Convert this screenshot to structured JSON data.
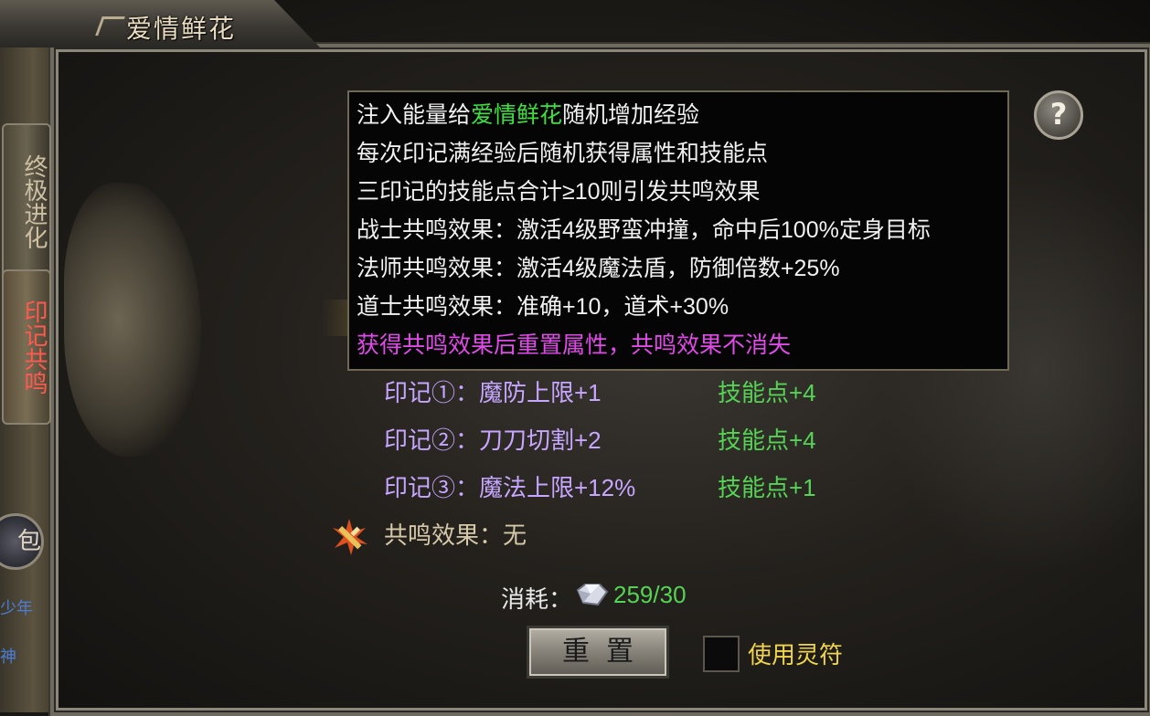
{
  "window": {
    "title": "爱情鲜花"
  },
  "side_tabs": [
    {
      "label": "终极进化"
    },
    {
      "label": "印记共鸣"
    }
  ],
  "side_partial": {
    "circle_text": "包",
    "blue1": "少年",
    "blue2": "神"
  },
  "help": {
    "label": "?"
  },
  "tooltip": {
    "line1_prefix": "注入能量给",
    "line1_highlight": "爱情鲜花",
    "line1_suffix": "随机增加经验",
    "line2": "每次印记满经验后随机获得属性和技能点",
    "line3": "三印记的技能点合计≥10则引发共鸣效果",
    "line4": "战士共鸣效果：激活4级野蛮冲撞，命中后100%定身目标",
    "line5": "法师共鸣效果：激活4级魔法盾，防御倍数+25%",
    "line6": "道士共鸣效果：准确+10，道术+30%",
    "line7": "获得共鸣效果后重置属性，共鸣效果不消失"
  },
  "marks": [
    {
      "label": "印记①：魔防上限+1",
      "skill": "技能点+4"
    },
    {
      "label": "印记②：刀刀切割+2",
      "skill": "技能点+4"
    },
    {
      "label": "印记③：魔法上限+12%",
      "skill": "技能点+1"
    }
  ],
  "resonance": {
    "label": "共鸣效果：无"
  },
  "cost": {
    "label": "消耗：",
    "value": "259/30"
  },
  "reset_button": {
    "label": "重置"
  },
  "talisman": {
    "label": "使用灵符",
    "checked": false
  },
  "colors": {
    "green": "#3ee03e",
    "purple": "#c6a6ff",
    "magenta": "#e04ae8",
    "yellow": "#f0d44c",
    "red_tab": "#ff5a4f"
  }
}
